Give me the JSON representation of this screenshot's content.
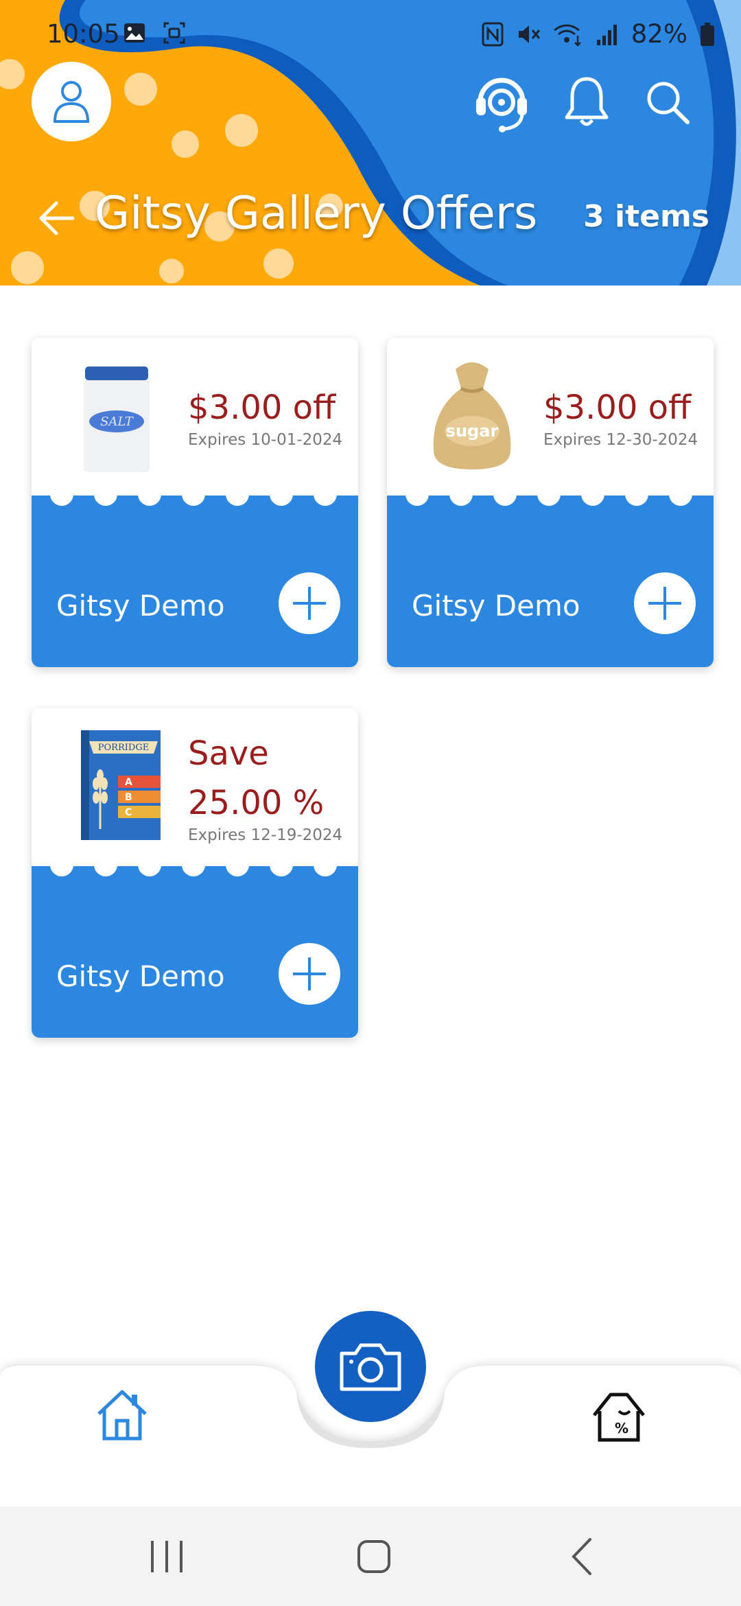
{
  "status_bar": {
    "time": "10:05",
    "battery_percent": "82%"
  },
  "header": {
    "title": "Gitsy Gallery Offers",
    "item_count": "3 items",
    "colors": {
      "blue": "#2b87df",
      "dark_blue": "#0f5cbf",
      "orange": "#ffa80a"
    }
  },
  "offers": [
    {
      "discount": "$3.00 off",
      "expires": "Expires 10-01-2024",
      "brand": "Gitsy Demo",
      "product_icon": "salt-jar-icon",
      "product_label": "SALT"
    },
    {
      "discount": "$3.00 off",
      "expires": "Expires 12-30-2024",
      "brand": "Gitsy Demo",
      "product_icon": "sugar-sack-icon",
      "product_label": "sugar"
    },
    {
      "discount_line1": "Save",
      "discount_line2": "25.00 %",
      "expires": "Expires 12-19-2024",
      "brand": "Gitsy Demo",
      "product_icon": "porridge-box-icon",
      "product_label": "PORRIDGE",
      "grades": [
        "A",
        "B",
        "C"
      ]
    }
  ],
  "bottom_nav": {
    "items": [
      "home-icon",
      "camera-icon",
      "deals-house-icon"
    ],
    "deals_badge": "%"
  }
}
